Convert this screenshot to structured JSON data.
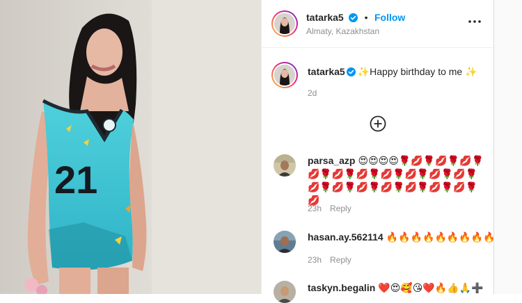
{
  "post": {
    "username": "tatarka5",
    "follow_label": "Follow",
    "location": "Almaty, Kazakhstan",
    "more_icon": "•••"
  },
  "caption": {
    "username": "tatarka5",
    "text": "✨Happy birthday to me ✨",
    "time": "2d"
  },
  "load_more_icon": "plus-circle-icon",
  "comments": [
    {
      "username": "parsa_azp",
      "text": "😍😍😍😍🌹💋🌹💋🌹💋🌹💋🌹💋🌹💋🌹💋🌹💋🌹💋🌹💋🌹💋🌹💋🌹💋🌹💋🌹💋🌹💋🌹💋🌹💋",
      "time": "23h",
      "reply_label": "Reply"
    },
    {
      "username": "hasan.ay.562114",
      "text": "🔥🔥🔥🔥🔥🔥🔥🔥🔥🔥",
      "time": "23h",
      "reply_label": "Reply"
    },
    {
      "username": "taskyn.begalin",
      "text": "❤️😍🥰😘❤️🔥👍🙏➕",
      "time": "",
      "reply_label": ""
    }
  ],
  "colors": {
    "follow": "#0095f6",
    "verified": "#0095f6",
    "jersey": "#3fc4d4"
  },
  "jersey_number": "21"
}
